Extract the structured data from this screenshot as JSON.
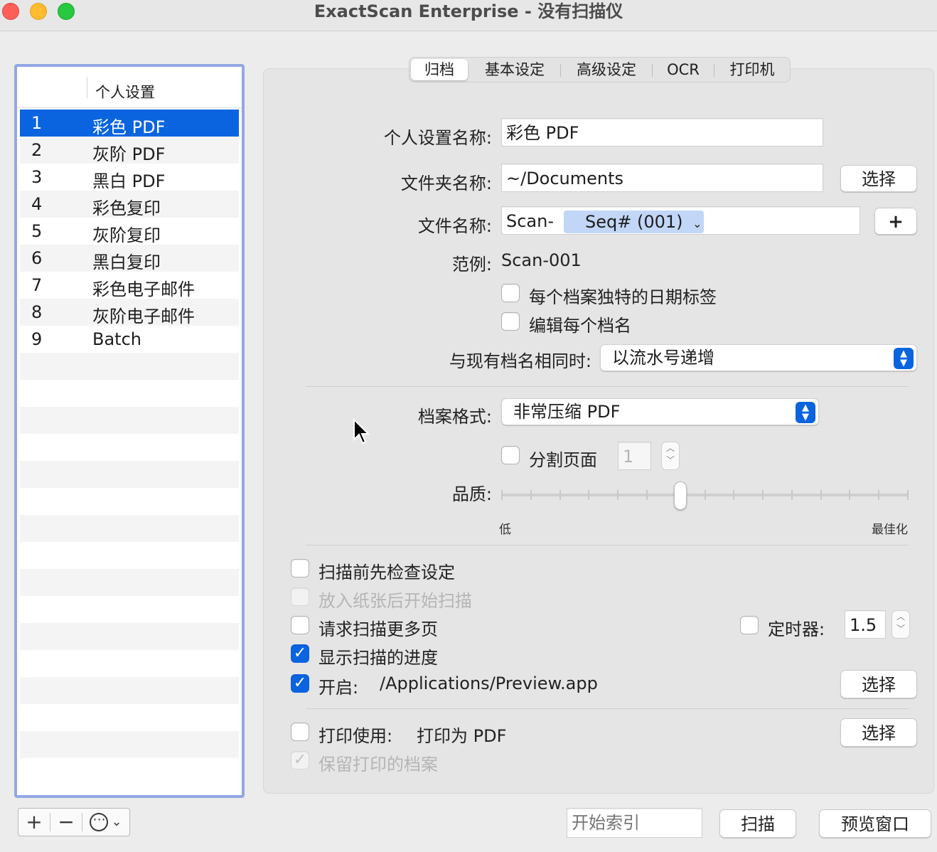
{
  "window": {
    "title": "ExactScan Enterprise - 没有扫描仪"
  },
  "profiles": {
    "header": "个人设置",
    "items": [
      {
        "num": "1",
        "name": "彩色 PDF"
      },
      {
        "num": "2",
        "name": "灰阶 PDF"
      },
      {
        "num": "3",
        "name": "黑白 PDF"
      },
      {
        "num": "4",
        "name": "彩色复印"
      },
      {
        "num": "5",
        "name": "灰阶复印"
      },
      {
        "num": "6",
        "name": "黑白复印"
      },
      {
        "num": "7",
        "name": "彩色电子邮件"
      },
      {
        "num": "8",
        "name": "灰阶电子邮件"
      },
      {
        "num": "9",
        "name": "Batch"
      }
    ],
    "selected_index": 0,
    "toolbar": {
      "add": "+",
      "remove": "−",
      "more": "⋯",
      "more_arrow": "⌄"
    }
  },
  "tabs": [
    "归档",
    "基本设定",
    "高级设定",
    "OCR",
    "打印机"
  ],
  "active_tab": 0,
  "form": {
    "profile_name_label": "个人设置名称:",
    "profile_name_value": "彩色 PDF",
    "folder_label": "文件夹名称:",
    "folder_value": "~/Documents",
    "choose": "选择",
    "filename_label": "文件名称:",
    "filename_prefix": "Scan-",
    "filename_token": "Seq# (001)",
    "token_arrow": "⌄",
    "plus": "+",
    "example_label": "范例:",
    "example_value": "Scan-001",
    "unique_date": "每个档案独特的日期标签",
    "edit_each": "编辑每个档名",
    "same_name_label": "与现有档名相同时:",
    "same_name_value": "以流水号递增",
    "format_label": "档案格式:",
    "format_value": "非常压缩 PDF",
    "split_pages": "分割页面",
    "split_value": "1",
    "quality_label": "品质:",
    "quality_low": "低",
    "quality_high": "最佳化",
    "quality_level": 0.44,
    "check_before_scan": "扫描前先检查设定",
    "start_on_paper": "放入纸张后开始扫描",
    "ask_more_pages": "请求扫描更多页",
    "timer_label": "定时器:",
    "timer_value": "1.5",
    "show_progress": "显示扫描的进度",
    "open_label": "开启:",
    "open_value": "/Applications/Preview.app",
    "print_label": "打印使用:",
    "print_value": "打印为 PDF",
    "keep_printed": "保留打印的档案"
  },
  "bottom": {
    "index_placeholder": "开始索引",
    "scan": "扫描",
    "preview": "预览窗口"
  }
}
